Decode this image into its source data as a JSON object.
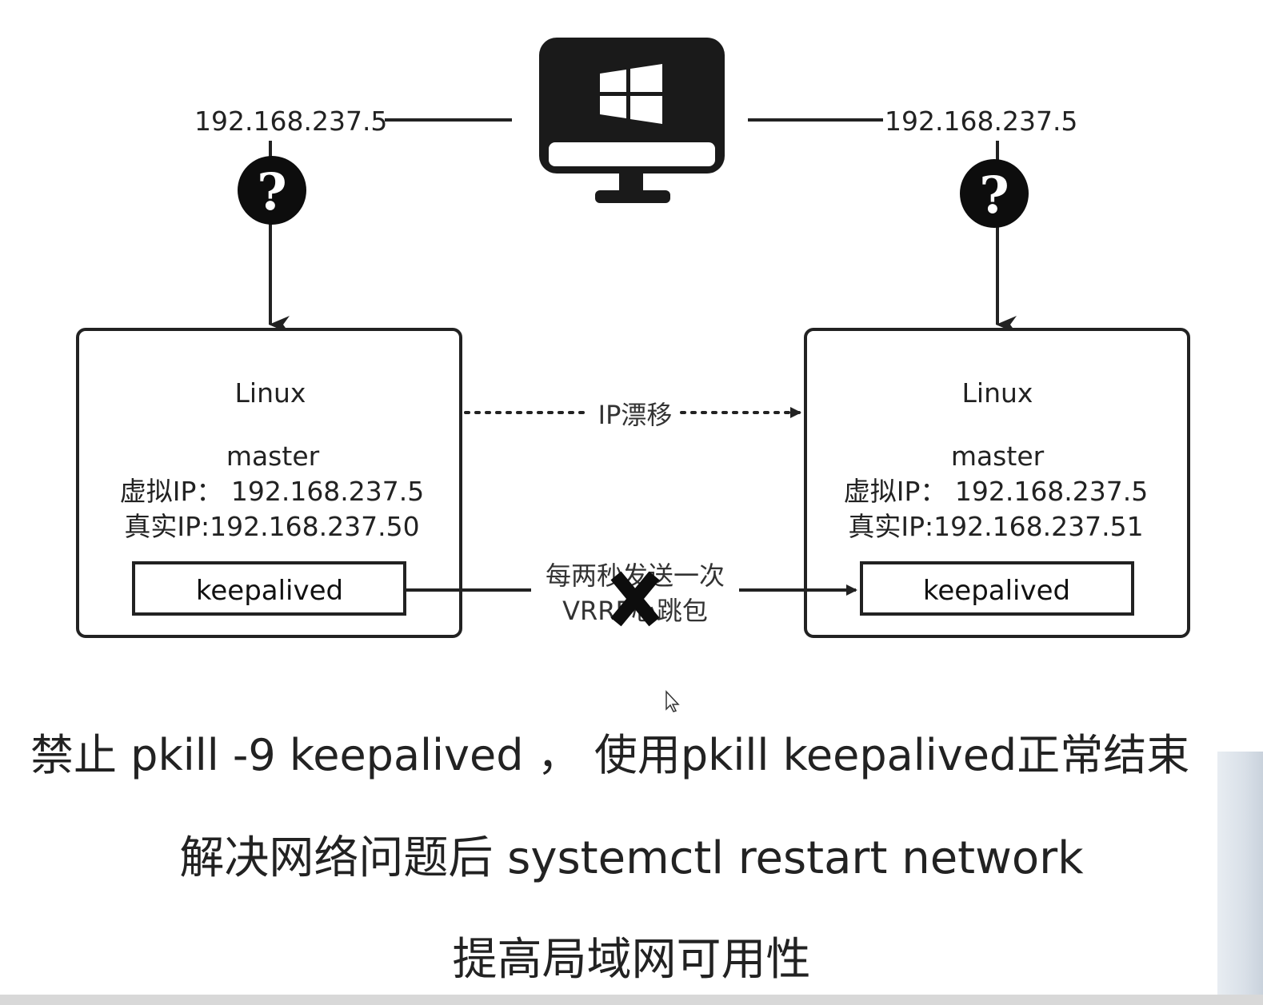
{
  "top_left_ip": "192.168.237.5",
  "top_right_ip": "192.168.237.5",
  "question_mark": "?",
  "left_node": {
    "os": "Linux",
    "role": "master",
    "virtual_ip": "虚拟IP：  192.168.237.5",
    "real_ip": "真实IP:192.168.237.50",
    "service": "keepalived"
  },
  "right_node": {
    "os": "Linux",
    "role": "master",
    "virtual_ip": "虚拟IP：  192.168.237.5",
    "real_ip": "真实IP:192.168.237.51",
    "service": "keepalived"
  },
  "ip_drift_label": "IP漂移",
  "heartbeat_label_line1": "每两秒发送一次",
  "heartbeat_label_line2": "VRRP心跳包",
  "icons": {
    "computer": "windows-monitor-icon",
    "question": "question-circle-icon",
    "cross": "x-cross-icon",
    "cursor": "mouse-cursor-icon"
  },
  "captions": [
    "禁止 pkill -9 keepalived ， 使用pkill keepalived正常结束",
    "解决网络问题后 systemctl restart network",
    "提高局域网可用性"
  ]
}
